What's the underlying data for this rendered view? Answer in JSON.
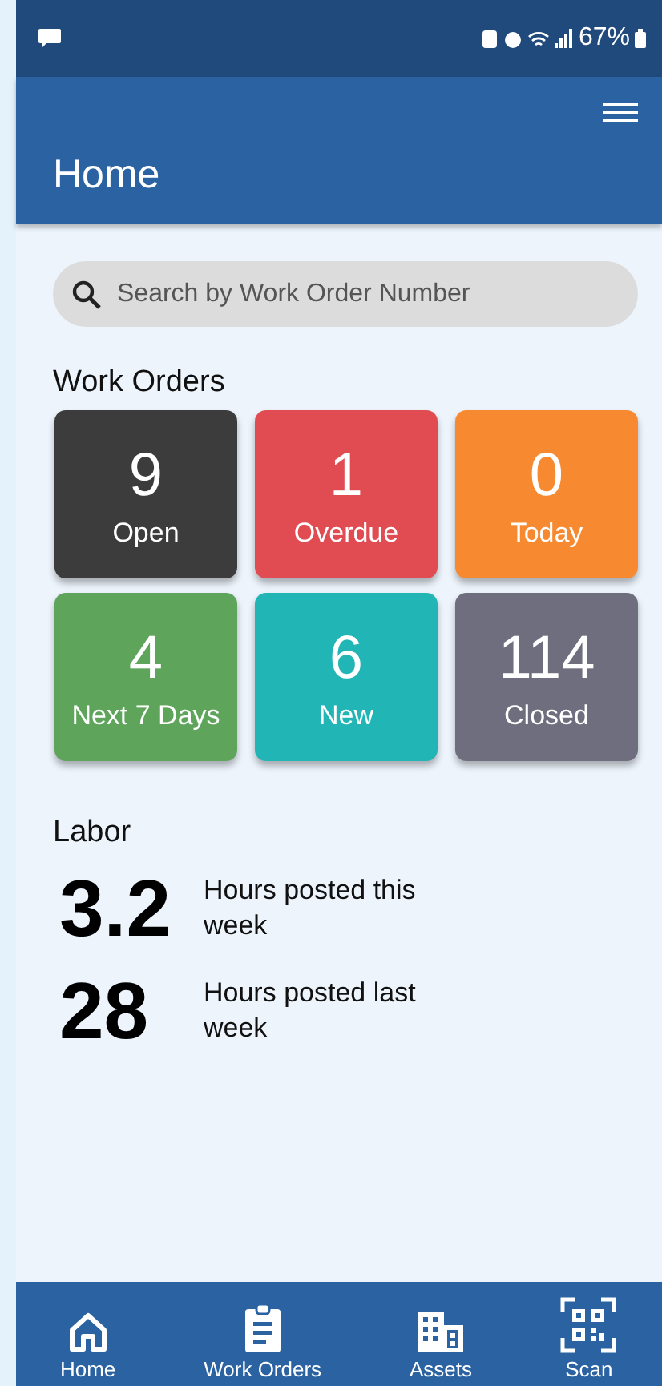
{
  "status_bar": {
    "battery": "67%"
  },
  "header": {
    "title": "Home"
  },
  "search": {
    "placeholder": "Search by Work Order Number"
  },
  "work_orders": {
    "title": "Work Orders",
    "tiles": [
      {
        "count": "9",
        "label": "Open",
        "color": "#3c3c3c"
      },
      {
        "count": "1",
        "label": "Overdue",
        "color": "#e14c52"
      },
      {
        "count": "0",
        "label": "Today",
        "color": "#f78a31"
      },
      {
        "count": "4",
        "label": "Next 7 Days",
        "color": "#5ea55b"
      },
      {
        "count": "6",
        "label": "New",
        "color": "#22b5b6"
      },
      {
        "count": "114",
        "label": "Closed",
        "color": "#6f6e7e"
      }
    ]
  },
  "labor": {
    "title": "Labor",
    "stats": [
      {
        "value": "3.2",
        "label": "Hours posted this week"
      },
      {
        "value": "28",
        "label": "Hours posted last week"
      }
    ]
  },
  "bottom_nav": [
    {
      "label": "Home",
      "kind": "home"
    },
    {
      "label": "Work Orders",
      "kind": "clipboard"
    },
    {
      "label": "Assets",
      "kind": "building"
    },
    {
      "label": "Scan",
      "kind": "qr"
    }
  ]
}
